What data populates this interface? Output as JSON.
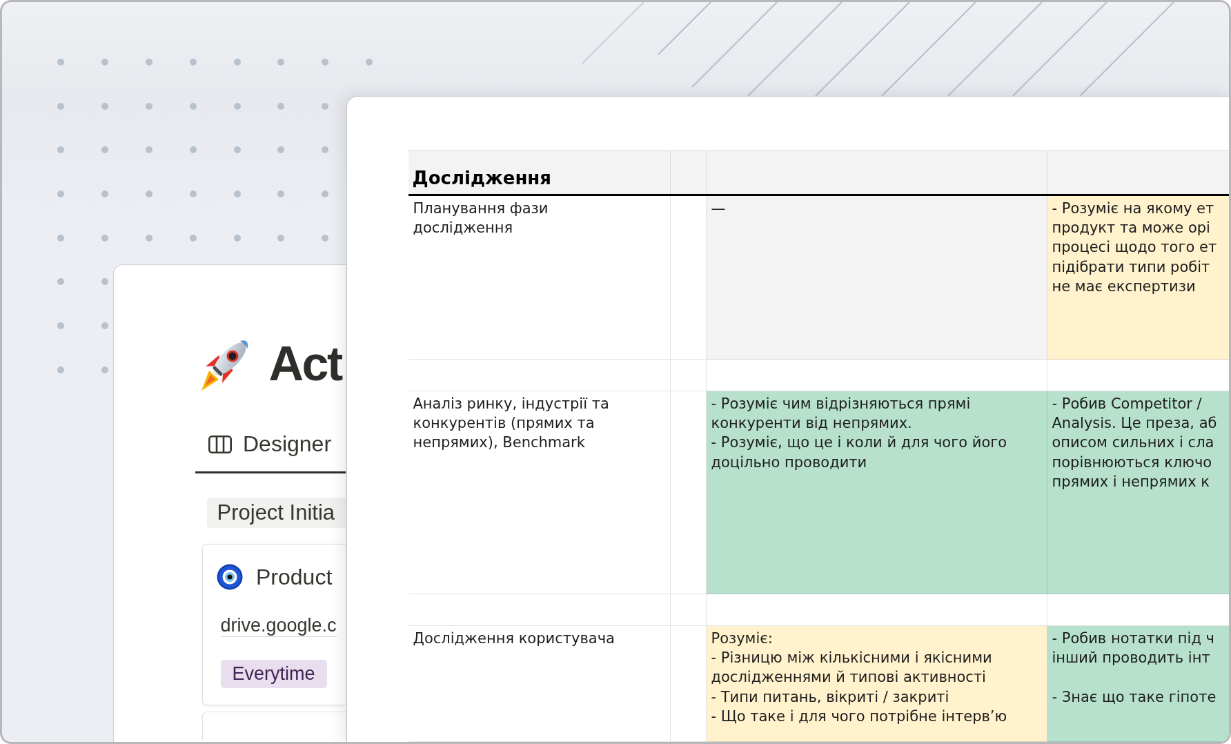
{
  "back_page": {
    "title": "Act",
    "tabs": [
      {
        "label": "Designer",
        "selected": true
      }
    ],
    "group": {
      "label": "Project Initia"
    },
    "cards": [
      {
        "title": "Product",
        "link": "drive.google.c",
        "tag": "Everytime"
      }
    ]
  },
  "sheet": {
    "section": "Дослідження",
    "rows": [
      {
        "topic": "Планування фази\nдослідження",
        "cells": [
          {
            "color": "#f3f3f3",
            "text": "—"
          },
          {
            "color": "#fff2cc",
            "text": "- Розуміє на якому ет\nпродукт та може орі\nпроцесі щодо того ет\nпідібрати типи робіт\nне має експертизи"
          }
        ]
      },
      {
        "topic": "Аналіз ринку, індустрії та\nконкурентів (прямих та\nнепрямих), Benchmark",
        "cells": [
          {
            "color": "#b7e1cd",
            "text": "- Розуміє чим відрізняються прямі\nконкуренти від непрямих.\n- Розуміє, що це і коли й для чого його\nдоцільно проводити"
          },
          {
            "color": "#b7e1cd",
            "text": "- Робив Competitor /\nAnalysis. Це преза, аб\nописом сильних і сла\nпорівнюються ключо\nпрямих і непрямих к"
          }
        ]
      },
      {
        "topic": "Дослідження користувача",
        "cells": [
          {
            "color": "#fff2cc",
            "text": "Розуміє:\n- Різницю між кількісними і якісними\nдослідженнями й типові активності\n- Типи питань, вікриті / закриті\n- Що таке і для чого потрібне інтерв’ю"
          },
          {
            "color": "#b7e1cd",
            "text": "- Робив нотатки під ч\nінший проводить інт\n\n- Знає що таке гіпоте"
          }
        ]
      }
    ]
  }
}
